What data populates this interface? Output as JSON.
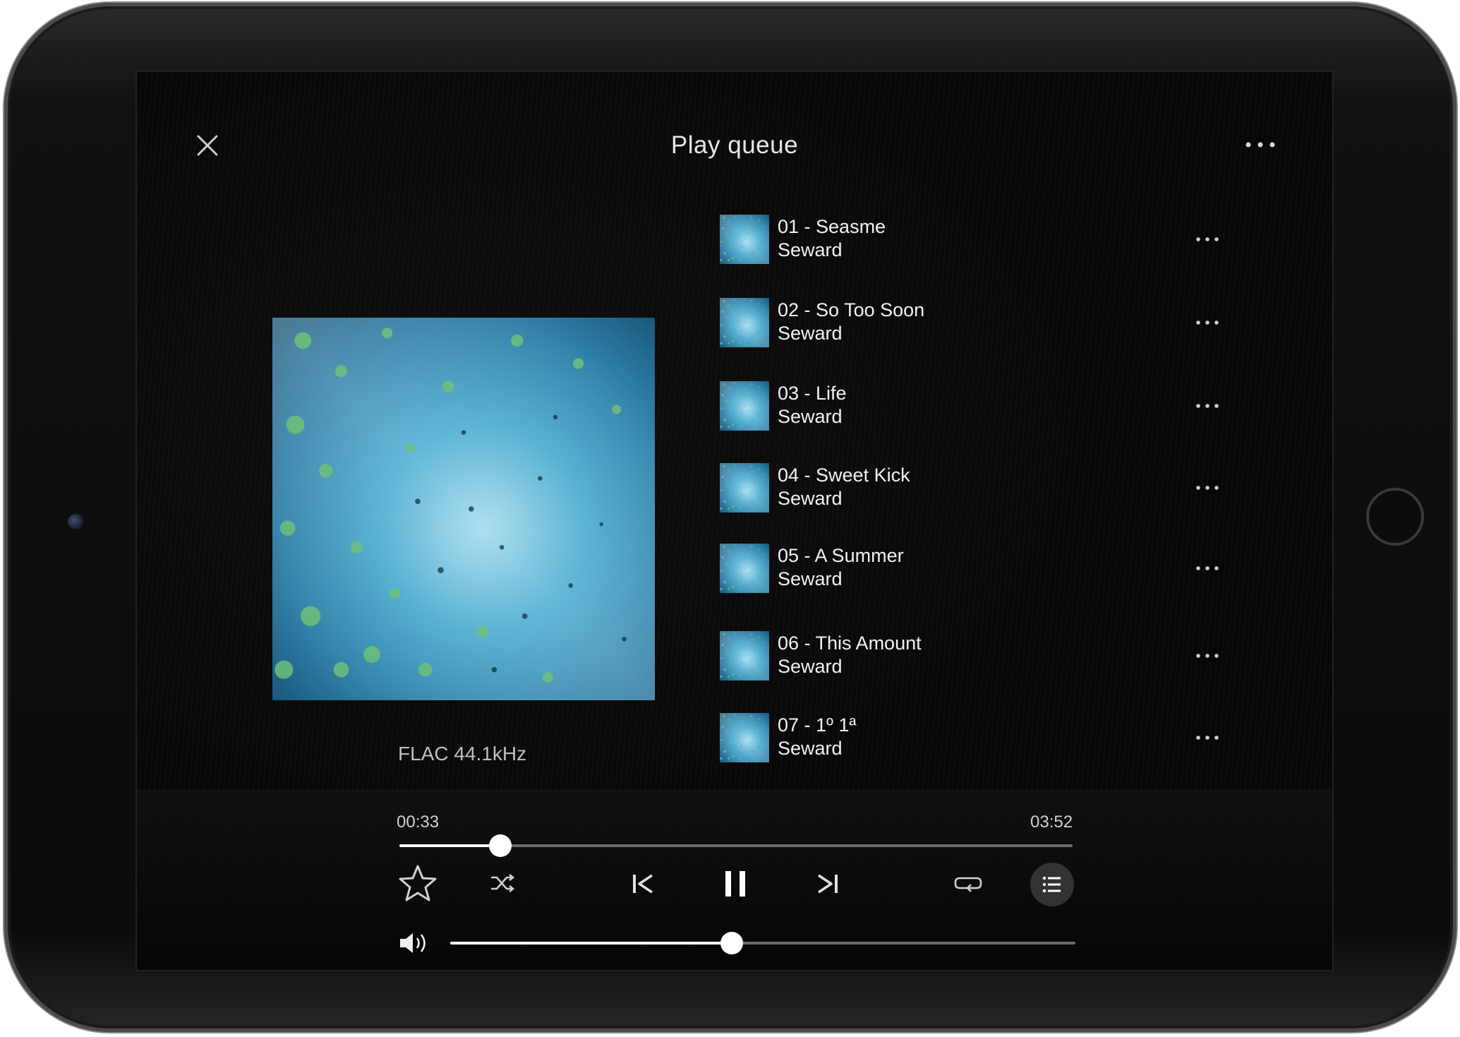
{
  "header": {
    "title": "Play queue",
    "close_icon": "close-icon",
    "more_icon": "more-horizontal-icon"
  },
  "now_playing": {
    "format": "FLAC 44.1kHz",
    "elapsed": "00:33",
    "duration": "03:52",
    "progress_fraction": 0.15,
    "volume_fraction": 0.45,
    "accent_color": "#ffffff"
  },
  "queue": {
    "items": [
      {
        "title": "01 - Seasme",
        "artist": "Seward"
      },
      {
        "title": "02 - So Too Soon",
        "artist": "Seward"
      },
      {
        "title": "03 - Life",
        "artist": "Seward"
      },
      {
        "title": "04 - Sweet Kick",
        "artist": "Seward"
      },
      {
        "title": "05 - A Summer",
        "artist": "Seward"
      },
      {
        "title": "06 - This Amount",
        "artist": "Seward"
      },
      {
        "title": "07 - 1º 1ª",
        "artist": "Seward"
      }
    ]
  },
  "controls": {
    "favorite": "star-icon",
    "shuffle": "shuffle-icon",
    "previous": "skip-previous-icon",
    "play_pause": "pause-icon",
    "next": "skip-next-icon",
    "repeat": "repeat-icon",
    "queue": "queue-list-icon",
    "volume": "volume-icon"
  }
}
